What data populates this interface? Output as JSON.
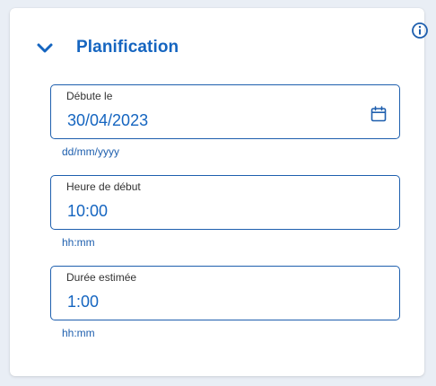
{
  "section": {
    "title": "Planification",
    "fields": [
      {
        "label": "Débute le",
        "value": "30/04/2023",
        "hint": "dd/mm/yyyy"
      },
      {
        "label": "Heure de début",
        "value": "10:00",
        "hint": "hh:mm"
      },
      {
        "label": "Durée estimée",
        "value": "1:00",
        "hint": "hh:mm"
      }
    ]
  },
  "colors": {
    "accent": "#1565c0",
    "border": "#1e5fae",
    "background": "#e9eef5",
    "card": "#ffffff"
  },
  "icons": [
    "info-icon",
    "chevron-down-icon",
    "calendar-icon"
  ]
}
